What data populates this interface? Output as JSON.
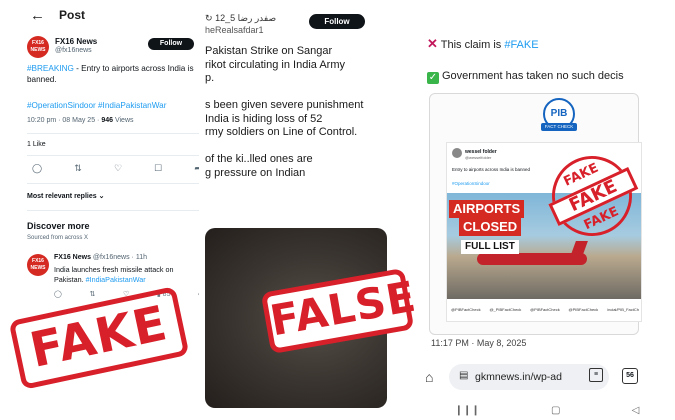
{
  "panel1": {
    "nav_title": "Post",
    "author_name": "FX16 News",
    "author_handle": "@fx16news",
    "avatar_text": "FX16 NEWS",
    "follow_label": "Follow",
    "post_text_tag": "#BREAKING",
    "post_text_body": " - Entry to airports across India is banned.",
    "post_hashtags": "#OperationSindoor #IndiaPakistanWar",
    "timestamp": "10:20 pm · 08 May 25 · ",
    "views_count": "946",
    "views_label": " Views",
    "likes": "1 Like",
    "sort_label": "Most relevant replies",
    "discover_title": "Discover more",
    "source_label": "Sourced from across X",
    "related": {
      "name": "FX16 News",
      "handle": "@fx16news · 11h",
      "text": "India launches fresh missile attack on Pakistan.",
      "hashtag": "#IndiaPakistanWar",
      "views": "85"
    },
    "stamp_label": "FAKE"
  },
  "panel2": {
    "name": "صفدر رضا",
    "handle_prefix": "12_5",
    "handle": "heRealsafdar1",
    "follow_label": "Follow",
    "text": "Pakistan Strike on Sangar\nrikot circulating in India Army\np.\n\ns been given severe punishment\n India is hiding loss of 52\nrmy soldiers on Line of Control.\n\n of the ki..lled ones are\ng pressure on Indian",
    "stamp_label": "FALSE"
  },
  "panel3": {
    "claim_prefix": "This claim is ",
    "claim_tag": "#FAKE",
    "gov_text": "Government has taken no such decis",
    "pib_logo": "PIB",
    "pib_sub": "FACT CHECK",
    "inner_user": "wessel folder",
    "inner_handle": "@wesselfolder",
    "inner_text": "Entry to airports across India is banned",
    "inner_tag": "#OperationSindoor",
    "headline_1": "AIRPORTS",
    "headline_2": "CLOSED",
    "headline_3": "FULL LIST",
    "footer_handles": [
      "@PIBFactCheck",
      "@_PIBFactCheck",
      "@PIBFactCheck",
      "@PIBFactCheck",
      "/ncial/PIB_FactCh"
    ],
    "stamp_top": "FAKE",
    "stamp_mid": "FAKE",
    "stamp_bot": "FAKE",
    "time": "11:17 PM · May 8, 2025",
    "url": "gkmnews.in/wp-ad",
    "tabs_count": "56"
  }
}
